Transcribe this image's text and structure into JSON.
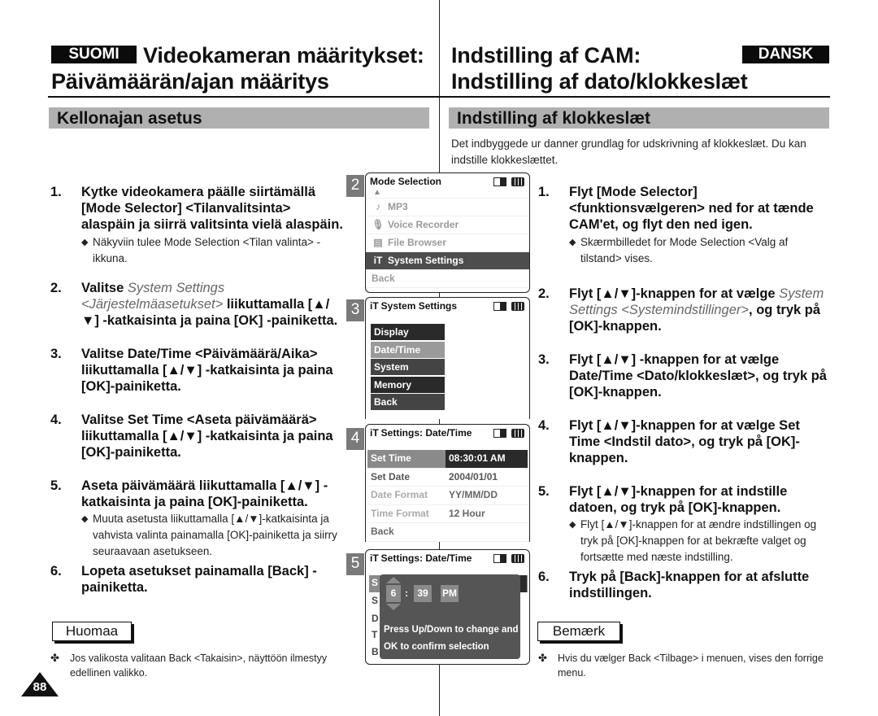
{
  "header": {
    "left_lang": "SUOMI",
    "left_title_line1": "Videokameran määritykset:",
    "left_title_line2": "Päivämäärän/ajan määritys",
    "right_lang": "DANSK",
    "right_title_line1": "Indstilling af CAM:",
    "right_title_line2": "Indstilling af dato/klokkeslæt"
  },
  "left": {
    "section": "Kellonajan asetus",
    "steps": [
      {
        "num": "1.",
        "text": "Kytke videokamera päälle siirtämällä [Mode Selector] <Tilanvalitsinta> alaspäin ja siirrä valitsinta vielä alaspäin.",
        "sub": "Näkyviin tulee Mode Selection <Tilan valinta> -ikkuna."
      },
      {
        "num": "2.",
        "pre": "Valitse ",
        "ital": "System Settings <Järjestelmäasetukset>",
        "post": " liikuttamalla [▲/▼] -katkaisinta ja paina [OK] -painiketta."
      },
      {
        "num": "3.",
        "text": "Valitse Date/Time <Päivämäärä/Aika> liikuttamalla [▲/▼] -katkaisinta ja paina [OK]-painiketta."
      },
      {
        "num": "4.",
        "text": "Valitse Set Time <Aseta päivämäärä> liikuttamalla [▲/▼] -katkaisinta ja paina [OK]-painiketta."
      },
      {
        "num": "5.",
        "text": "Aseta päivämäärä liikuttamalla [▲/▼] -katkaisinta ja paina [OK]-painiketta.",
        "sub": "Muuta asetusta liikuttamalla [▲/▼]-katkaisinta ja vahvista valinta painamalla [OK]-painiketta ja siirry seuraavaan asetukseen."
      },
      {
        "num": "6.",
        "text": "Lopeta asetukset painamalla [Back] -painiketta."
      }
    ],
    "note_label": "Huomaa",
    "note_text": "Jos valikosta valitaan Back <Takaisin>, näyttöön ilmestyy edellinen valikko.",
    "page_number": "88"
  },
  "right": {
    "section": "Indstilling af klokkeslæt",
    "intro": "Det indbyggede ur danner grundlag for udskrivning af klokkeslæt. Du kan indstille klokkeslættet.",
    "steps": [
      {
        "num": "1.",
        "text": "Flyt [Mode Selector] <funktionsvælgeren> ned for at tænde CAM'et, og flyt den ned igen.",
        "sub": "Skærmbilledet for Mode Selection <Valg af tilstand> vises."
      },
      {
        "num": "2.",
        "pre": "Flyt [▲/▼]-knappen for at vælge ",
        "ital": "System Settings <Systemindstillinger>",
        "post": ", og tryk på [OK]-knappen."
      },
      {
        "num": "3.",
        "text": "Flyt [▲/▼] -knappen for at vælge Date/Time <Dato/klokkeslæt>, og tryk på [OK]-knappen."
      },
      {
        "num": "4.",
        "text": "Flyt [▲/▼]-knappen for at vælge Set Time <Indstil dato>, og tryk på [OK]-knappen."
      },
      {
        "num": "5.",
        "text": "Flyt [▲/▼]-knappen for at indstille datoen, og tryk på [OK]-knappen.",
        "sub": "Flyt [▲/▼]-knappen for at ændre indstillingen og tryk på [OK]-knappen for at bekræfte valget og fortsætte med næste indstilling."
      },
      {
        "num": "6.",
        "text": "Tryk på [Back]-knappen for at afslutte indstillingen."
      }
    ],
    "note_label": "Bemærk",
    "note_text": "Hvis du vælger Back <Tilbage> i menuen, vises den forrige menu."
  },
  "screens": {
    "s2": {
      "step": "2",
      "title": "Mode Selection",
      "items": [
        {
          "icon": "♪",
          "label": "MP3"
        },
        {
          "icon": "🎙",
          "label": "Voice Recorder"
        },
        {
          "icon": "▤",
          "label": "File Browser"
        },
        {
          "icon": "⫯T",
          "label": "System Settings",
          "selected": true
        }
      ],
      "back": "Back"
    },
    "s3": {
      "step": "3",
      "title": "System Settings",
      "items": [
        "Display",
        "Date/Time",
        "System",
        "Memory",
        "Back"
      ],
      "selected": "Date/Time"
    },
    "s4": {
      "step": "4",
      "title": "Settings: Date/Time",
      "rows": [
        {
          "key": "Set Time",
          "value": "08:30:01 AM"
        },
        {
          "key": "Set Date",
          "value": "2004/01/01"
        },
        {
          "key": "Date Format",
          "value": "YY/MM/DD"
        },
        {
          "key": "Time Format",
          "value": "12 Hour"
        }
      ],
      "back": "Back"
    },
    "s5": {
      "step": "5",
      "title": "Settings: Date/Time",
      "hour": "6",
      "colon": ":",
      "minute": "39",
      "ampm": "PM",
      "hint_line1": "Press Up/Down to change and",
      "hint_line2": "OK to confirm selection",
      "bg_letters": [
        "S",
        "S",
        "D",
        "T",
        "B"
      ]
    }
  }
}
